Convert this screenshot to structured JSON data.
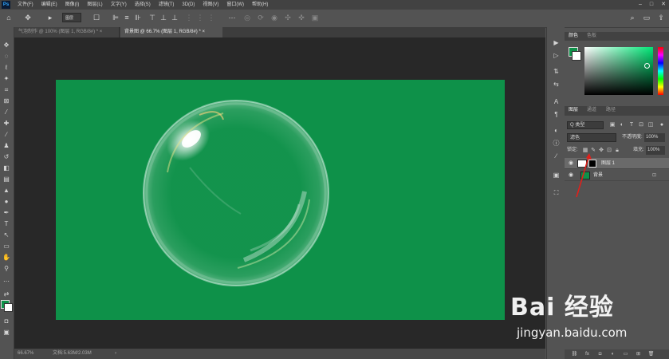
{
  "app": {
    "logo": "Ps"
  },
  "menu": [
    "文件(F)",
    "编辑(E)",
    "图像(I)",
    "图层(L)",
    "文字(Y)",
    "选择(S)",
    "滤镜(T)",
    "3D(D)",
    "视图(V)",
    "窗口(W)",
    "帮助(H)"
  ],
  "window_controls": {
    "minimize": "–",
    "restore": "□",
    "close": "✕"
  },
  "options": {
    "layer_select": "图层"
  },
  "tabs": [
    {
      "label": "气泡制作 @ 100% (图层 1, RGB/8#) *",
      "close": "×",
      "active": false
    },
    {
      "label": "背景图 @ 66.7% (图层 1, RGB/8#) *",
      "close": "×",
      "active": true
    }
  ],
  "status": {
    "zoom": "66.67%",
    "doc_info": "文档:5.63M/2.03M",
    "arrow": "›"
  },
  "color_panel": {
    "tabs": [
      "颜色",
      "色板"
    ],
    "foreground": "#0e9149",
    "background": "#ffffff"
  },
  "layers_panel": {
    "tabs": [
      "图层",
      "通道",
      "路径"
    ],
    "filter_label": "Q 类型",
    "blend_mode": "滤色",
    "opacity_label": "不透明度:",
    "opacity_value": "100%",
    "lock_label": "锁定:",
    "fill_label": "填充:",
    "fill_value": "100%",
    "layers": [
      {
        "name": "图层 1",
        "selected": true,
        "thumb": "bubble"
      },
      {
        "name": "背景",
        "selected": false,
        "thumb": "green"
      }
    ]
  },
  "canvas": {
    "color": "#0e9149"
  },
  "watermark": {
    "logo": "Bai 经验",
    "url": "jingyan.baidu.com"
  }
}
